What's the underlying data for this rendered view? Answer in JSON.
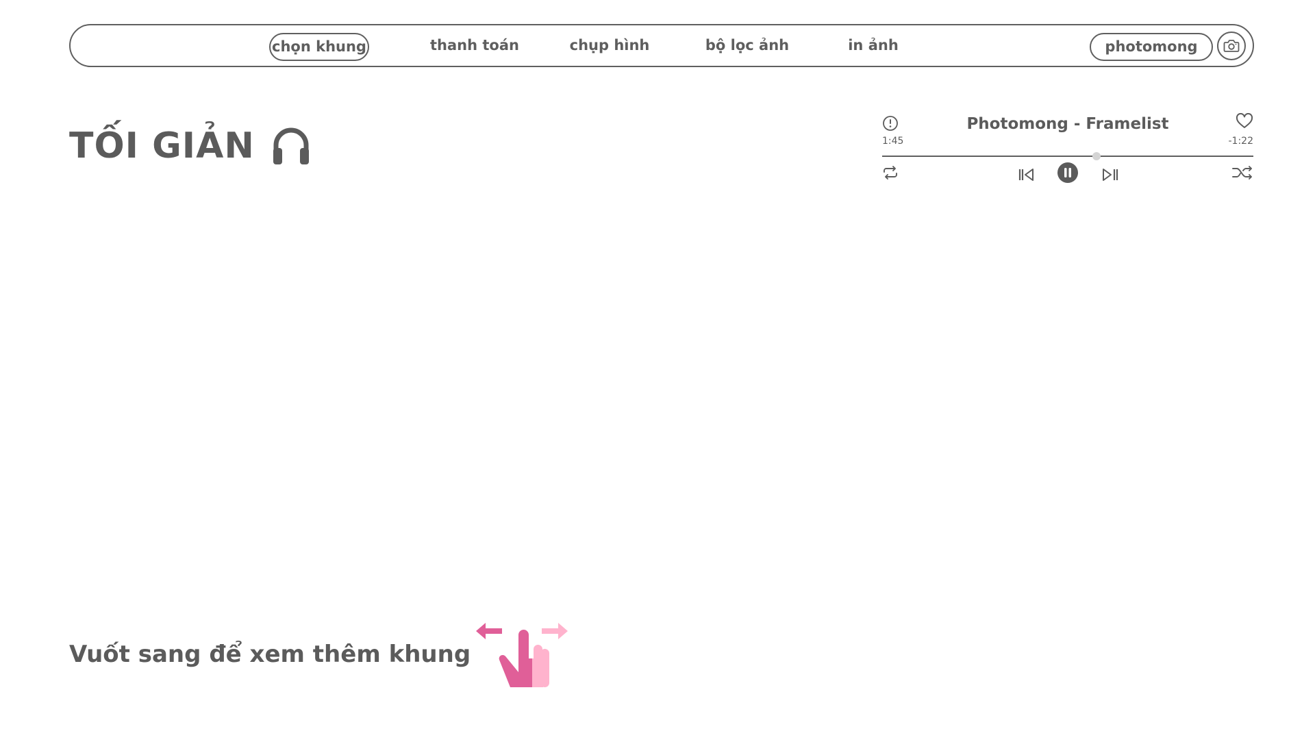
{
  "nav": {
    "items": [
      {
        "label": "chọn khung",
        "active": true
      },
      {
        "label": "thanh toán",
        "active": false
      },
      {
        "label": "chụp hình",
        "active": false
      },
      {
        "label": "bộ lọc ảnh",
        "active": false
      },
      {
        "label": "in ảnh",
        "active": false
      }
    ],
    "brand": "photomong",
    "camera_icon": "camera-icon"
  },
  "title": {
    "text": "TỐI GIẢN",
    "icon": "headphones-icon"
  },
  "player": {
    "song": "Photomong - Framelist",
    "elapsed": "1:45",
    "remaining": "-1:22",
    "progress_fraction": 0.577,
    "controls": [
      "info-icon",
      "heart-icon",
      "repeat-icon",
      "previous-icon",
      "pause-icon",
      "next-icon",
      "shuffle-icon"
    ]
  },
  "swipe": {
    "text": "Vuốt sang để xem thêm khung",
    "icon": "swipe-gesture-icon"
  },
  "colors": {
    "text": "#5b5b5b",
    "border": "#5f5f5f",
    "accent_pink": "#e05f98",
    "accent_pink_light": "#ffb3cd"
  }
}
